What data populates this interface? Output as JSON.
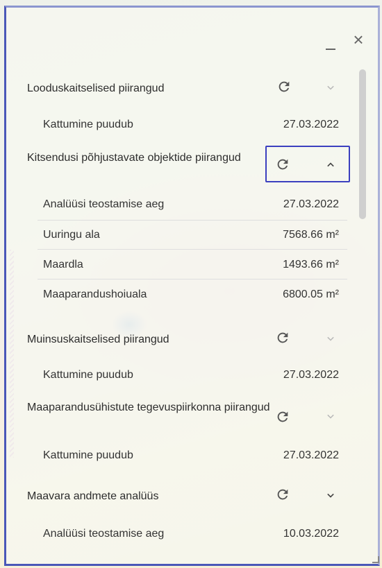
{
  "window": {
    "minimize_label": "_",
    "close_label": "×"
  },
  "sections": [
    {
      "title": "Looduskaitselised piirangud",
      "expanded": false,
      "rows": [
        {
          "label": "Kattumine puudub",
          "value": "27.03.2022"
        }
      ]
    },
    {
      "title": "Kitsendusi põhjustavate objektide piirangud",
      "expanded": true,
      "rows": [
        {
          "label": "Analüüsi teostamise aeg",
          "value": "27.03.2022"
        },
        {
          "label": "Uuringu ala",
          "value": "7568.66 m²"
        },
        {
          "label": "Maardla",
          "value": "1493.66 m²"
        },
        {
          "label": "Maaparandushoiuala",
          "value": "6800.05 m²"
        }
      ]
    },
    {
      "title": "Muinsuskaitselised piirangud",
      "expanded": false,
      "rows": [
        {
          "label": "Kattumine puudub",
          "value": "27.03.2022"
        }
      ]
    },
    {
      "title": "Maaparandusühistute tegevuspiirkonna piirangud",
      "expanded": false,
      "rows": [
        {
          "label": "Kattumine puudub",
          "value": "27.03.2022"
        }
      ]
    },
    {
      "title": "Maavara andmete analüüs",
      "expanded": false,
      "rows": [
        {
          "label": "Analüüsi teostamise aeg",
          "value": "10.03.2022"
        }
      ]
    }
  ],
  "icons": {
    "refresh": "refresh-icon",
    "chevron_down": "chevron-down-icon",
    "chevron_up": "chevron-up-icon"
  },
  "colors": {
    "focus_border": "#3b3fbf",
    "frame_border": "#4a57b8",
    "icon_dark": "#555555",
    "icon_light": "#b8b8b8"
  }
}
